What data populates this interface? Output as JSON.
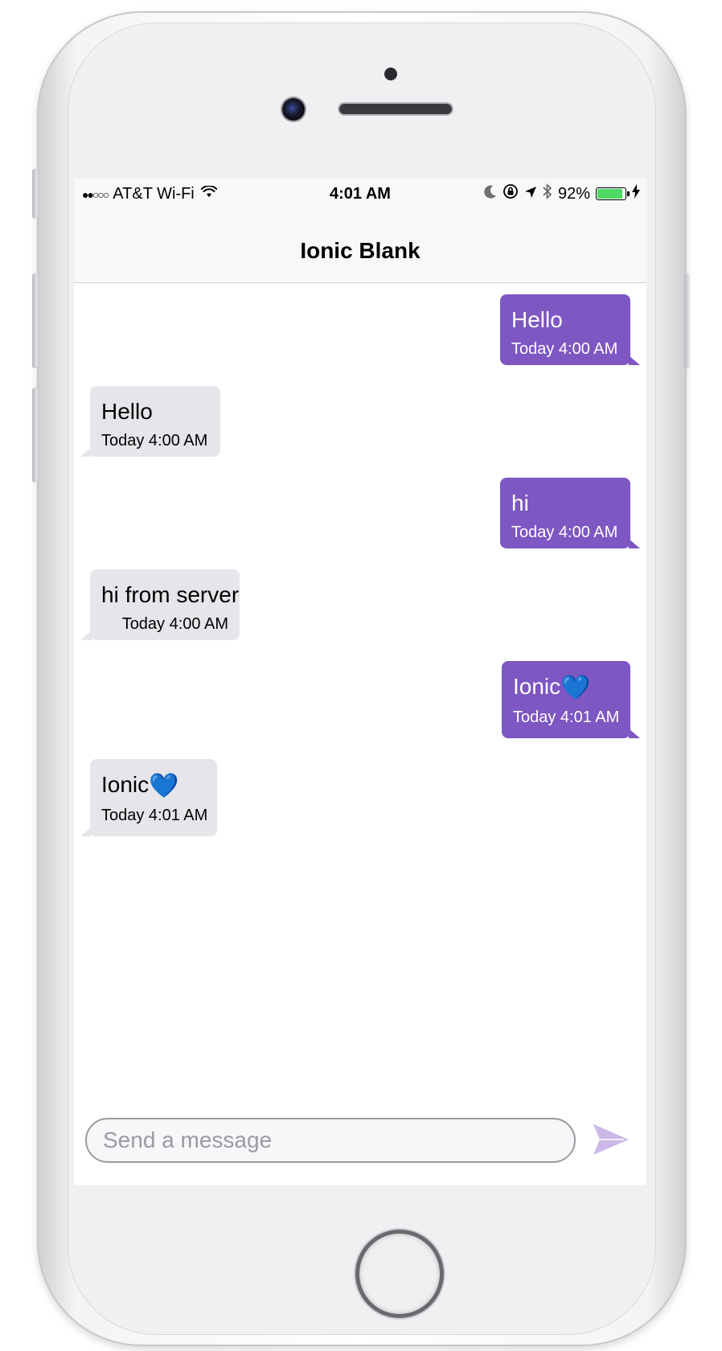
{
  "status_bar": {
    "signal": "●●○○○",
    "carrier": "AT&T Wi-Fi",
    "time": "4:01 AM",
    "battery_percent": "92%",
    "battery_level": 0.92,
    "icons": [
      "wifi-icon",
      "moon-icon",
      "orientation-lock-icon",
      "location-arrow-icon",
      "bluetooth-icon",
      "battery-icon",
      "charging-bolt-icon"
    ]
  },
  "nav": {
    "title": "Ionic Blank"
  },
  "messages": [
    {
      "direction": "out",
      "text": "Hello",
      "time": "Today 4:00 AM"
    },
    {
      "direction": "in",
      "text": "Hello",
      "time": "Today 4:00 AM"
    },
    {
      "direction": "out",
      "text": "hi",
      "time": "Today 4:00 AM"
    },
    {
      "direction": "in",
      "text": "hi from server",
      "time": "Today 4:00 AM"
    },
    {
      "direction": "out",
      "text": "Ionic",
      "emoji": "💙",
      "time": "Today 4:01 AM"
    },
    {
      "direction": "in",
      "text": "Ionic",
      "emoji": "💙",
      "time": "Today 4:01 AM"
    }
  ],
  "composer": {
    "value": "",
    "placeholder": "Send a message",
    "send_icon": "send-icon"
  },
  "colors": {
    "outgoing_bubble": "#7e57c2",
    "incoming_bubble": "#e6e6ea",
    "send_icon": "#c9b8e8",
    "battery_fill": "#4cd964"
  }
}
